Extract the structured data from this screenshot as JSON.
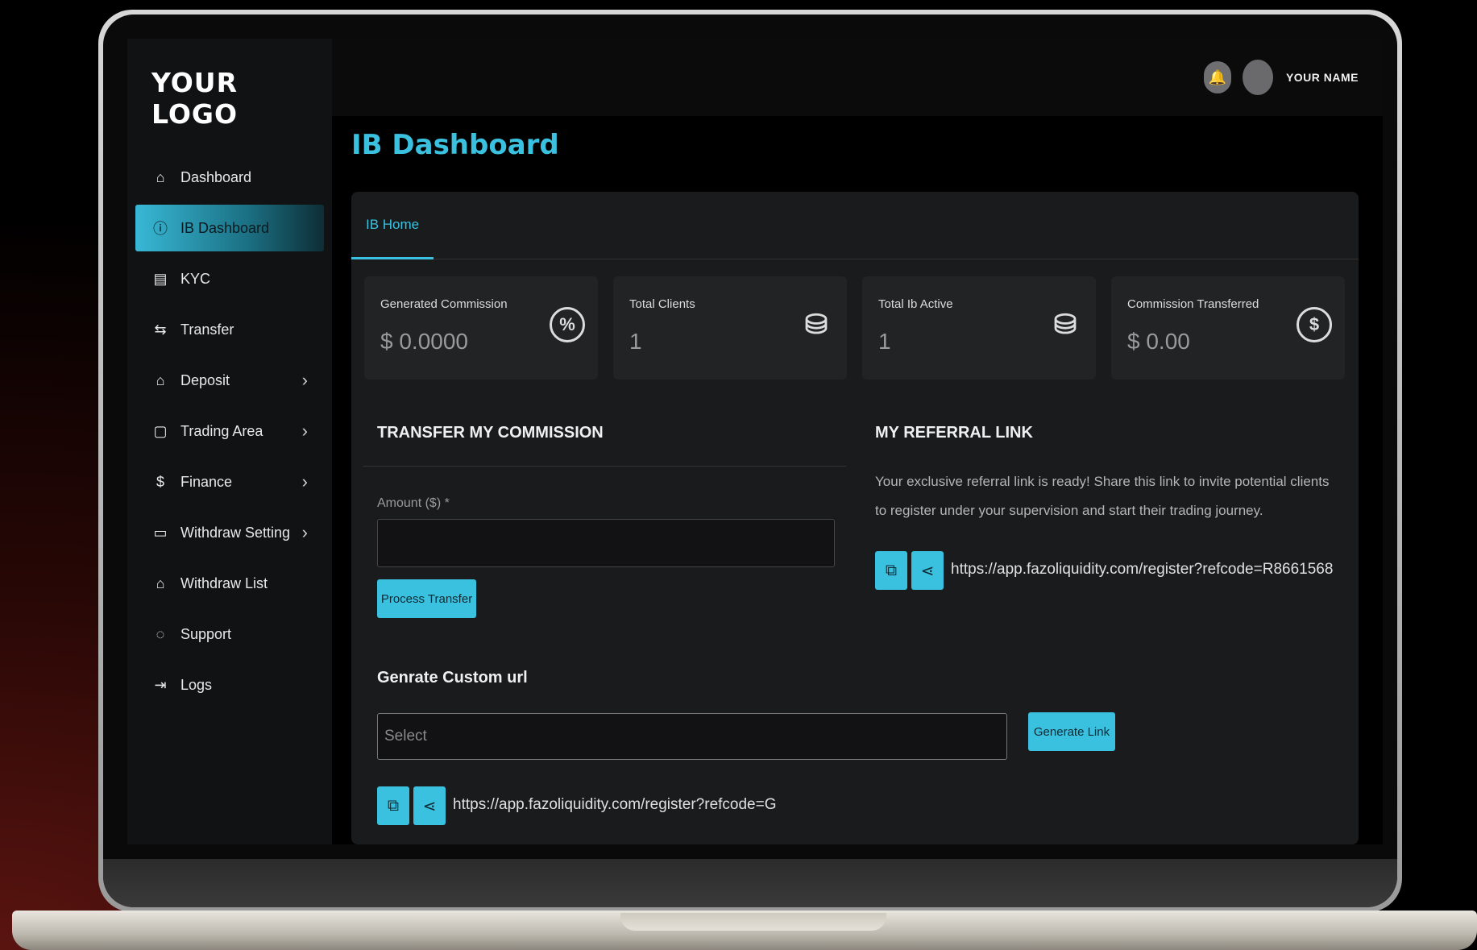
{
  "sidebar": {
    "logo": "YOUR LOGO",
    "items": [
      {
        "label": "Dashboard",
        "icon": "home-icon",
        "glyph": "⌂",
        "active": false,
        "has_submenu": false
      },
      {
        "label": "IB Dashboard",
        "icon": "info-icon",
        "glyph": "ⓘ",
        "active": true,
        "has_submenu": false
      },
      {
        "label": "KYC",
        "icon": "document-icon",
        "glyph": "▤",
        "active": false,
        "has_submenu": false
      },
      {
        "label": "Transfer",
        "icon": "transfer-icon",
        "glyph": "⇆",
        "active": false,
        "has_submenu": false
      },
      {
        "label": "Deposit",
        "icon": "bank-icon",
        "glyph": "⌂",
        "active": false,
        "has_submenu": true
      },
      {
        "label": "Trading Area",
        "icon": "note-icon",
        "glyph": "▢",
        "active": false,
        "has_submenu": true
      },
      {
        "label": "Finance",
        "icon": "dollar-icon",
        "glyph": "$",
        "active": false,
        "has_submenu": true
      },
      {
        "label": "Withdraw Setting",
        "icon": "calendar-icon",
        "glyph": "▭",
        "active": false,
        "has_submenu": true
      },
      {
        "label": "Withdraw List",
        "icon": "bank-icon",
        "glyph": "⌂",
        "active": false,
        "has_submenu": false
      },
      {
        "label": "Support",
        "icon": "chat-icon",
        "glyph": "◌",
        "active": false,
        "has_submenu": false
      },
      {
        "label": "Logs",
        "icon": "login-icon",
        "glyph": "⇥",
        "active": false,
        "has_submenu": false
      }
    ],
    "chevron": "›"
  },
  "header": {
    "username": "YOUR NAME",
    "bell_glyph": "🔔"
  },
  "page": {
    "title": "IB Dashboard",
    "tab": "IB Home"
  },
  "stats": [
    {
      "label": "Generated Commission",
      "value": "$ 0.0000",
      "icon": "percent-icon",
      "glyph": "%"
    },
    {
      "label": "Total Clients",
      "value": "1",
      "icon": "hand-money-icon",
      "glyph": "⛁"
    },
    {
      "label": "Total Ib Active",
      "value": "1",
      "icon": "hand-money-icon",
      "glyph": "⛁"
    },
    {
      "label": "Commission Transferred",
      "value": "$ 0.00",
      "icon": "refresh-dollar-icon",
      "glyph": "$"
    }
  ],
  "transfer": {
    "title": "TRANSFER MY COMMISSION",
    "amount_label": "Amount ($) *",
    "amount_value": "",
    "button": "Process Transfer"
  },
  "referral": {
    "title": "MY REFERRAL LINK",
    "description": "Your exclusive referral link is ready! Share this link to invite potential clients to register under your supervision and start their trading journey.",
    "link": "https://app.fazoliquidity.com/register?refcode=R8661568",
    "copy_glyph": "⧉",
    "share_glyph": "⋖"
  },
  "custom_url": {
    "title": "Genrate Custom url",
    "select_placeholder": "Select",
    "button": "Generate Link",
    "link": "https://app.fazoliquidity.com/register?refcode=G"
  },
  "colors": {
    "accent": "#3bc1e0",
    "background": "#000000",
    "card": "#1a1b1d"
  }
}
